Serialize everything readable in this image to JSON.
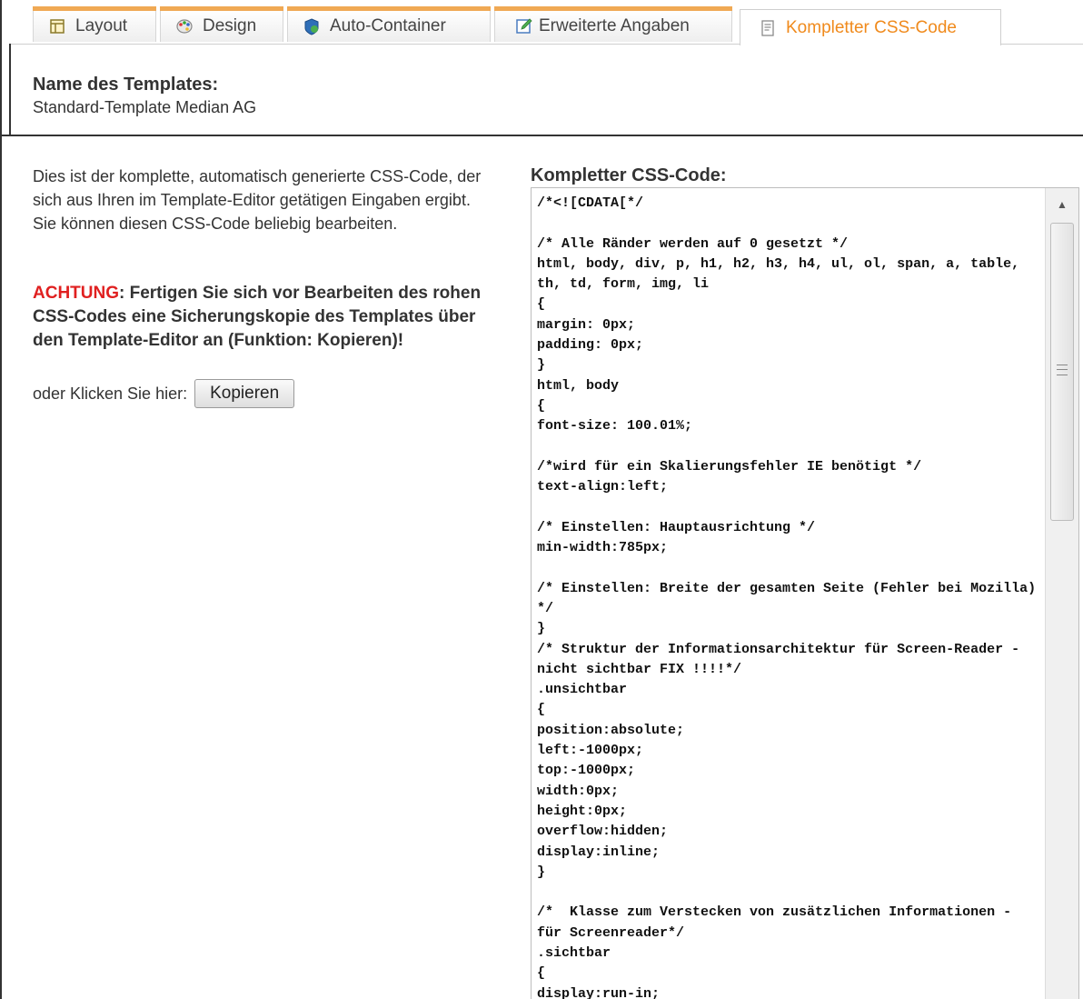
{
  "tabs": [
    {
      "label": "Layout",
      "icon": "layout-icon",
      "active": false
    },
    {
      "label": "Design",
      "icon": "palette-icon",
      "active": false
    },
    {
      "label": "Auto-Container",
      "icon": "container-icon",
      "active": false
    },
    {
      "label": "Erweiterte Angaben",
      "icon": "edit-icon",
      "active": false
    },
    {
      "label": "Kompletter CSS-Code",
      "icon": "document-icon",
      "active": true
    }
  ],
  "template": {
    "name_label": "Name des Templates:",
    "name_value": "Standard-Template Median AG"
  },
  "info": {
    "description": "Dies ist der komplette, automatisch generierte CSS-Code, der sich aus Ihren im Template-Editor getätigen Eingaben ergibt. Sie können diesen CSS-Code beliebig bearbeiten.",
    "warning_label": "ACHTUNG",
    "warning_text": ": Fertigen Sie sich vor Bearbeiten des rohen CSS-Codes eine Sicherungskopie des Templates über den Template-Editor an (Funktion: Kopieren)!",
    "copy_prompt": "oder Klicken Sie hier:",
    "copy_button": "Kopieren"
  },
  "code_editor": {
    "label": "Kompletter CSS-Code:",
    "content": "/*<![CDATA[*/\n\n/* Alle Ränder werden auf 0 gesetzt */\nhtml, body, div, p, h1, h2, h3, h4, ul, ol, span, a, table, th, td, form, img, li\n{\nmargin: 0px;\npadding: 0px;\n}\nhtml, body\n{\nfont-size: 100.01%;\n\n/*wird für ein Skalierungsfehler IE benötigt */\ntext-align:left;\n\n/* Einstellen: Hauptausrichtung */\nmin-width:785px;\n\n/* Einstellen: Breite der gesamten Seite (Fehler bei Mozilla) */\n}\n/* Struktur der Informationsarchitektur für Screen-Reader - nicht sichtbar FIX !!!!*/\n.unsichtbar\n{\nposition:absolute;\nleft:-1000px;\ntop:-1000px;\nwidth:0px;\nheight:0px;\noverflow:hidden;\ndisplay:inline;\n}\n\n/*  Klasse zum Verstecken von zusätzlichen Informationen - für Screenreader*/\n.sichtbar\n{\ndisplay:run-in;"
  },
  "colors": {
    "active_tab_text": "#f08a1c",
    "tab_accent": "#f0a954",
    "warning": "#e02020"
  }
}
